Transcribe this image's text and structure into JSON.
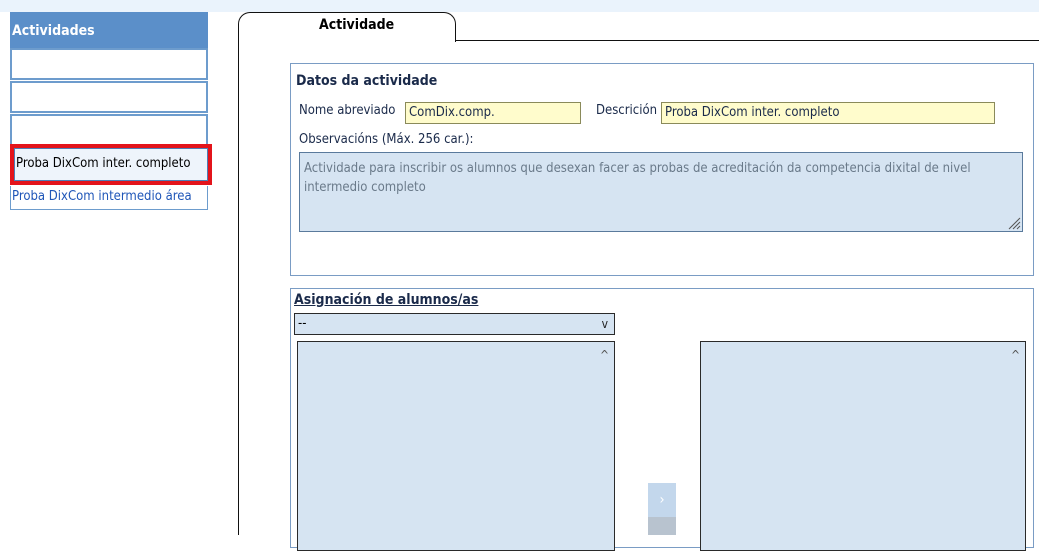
{
  "sidebar": {
    "header": "Actividades",
    "selected_item": "Proba DixCom inter. completo",
    "link_item": "Proba DixCom intermedio área"
  },
  "tabs": {
    "active": "Actividade"
  },
  "datos": {
    "title": "Datos da actividade",
    "nome_label": "Nome abreviado",
    "nome_value": "ComDix.comp.",
    "descricion_label": "Descrición",
    "descricion_value": "Proba DixCom inter. completo",
    "obs_label": "Observacións (Máx. 256 car.):",
    "obs_value": "Actividade para inscribir os alumnos que desexan facer as probas de acreditación da competencia dixital de nivel intermedio completo"
  },
  "asignacion": {
    "title": "Asignación de alumnos/as",
    "select_value": "--",
    "move_right": "›"
  },
  "icons": {
    "dropdown": "v",
    "scroll_up": "^"
  }
}
